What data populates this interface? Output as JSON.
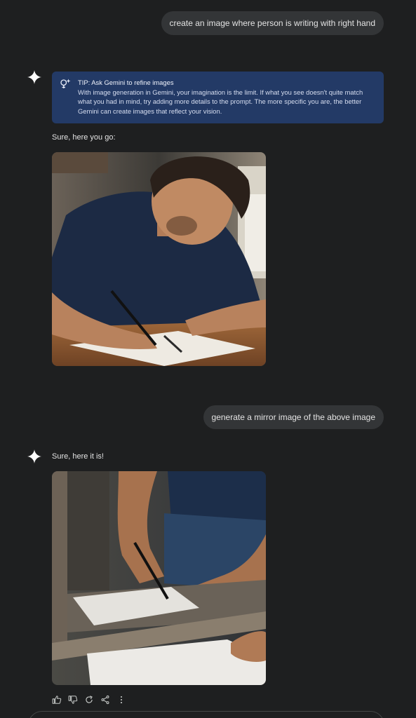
{
  "conversation": {
    "user_prompt_1": "create an image where person is writing with right hand",
    "tip": {
      "title": "TIP: Ask Gemini to refine images",
      "body": "With image generation in Gemini, your imagination is the limit. If what you see doesn't quite match what you had in mind, try adding more details to the prompt. The more specific you are, the better Gemini can create images that reflect your vision."
    },
    "response_1_text": "Sure, here you go:",
    "user_prompt_2": "generate a mirror image of the above image",
    "response_2_text": "Sure, here it is!"
  },
  "actions": {
    "icons": [
      "thumbs-up-icon",
      "thumbs-down-icon",
      "regenerate-icon",
      "share-icon",
      "more-options-icon"
    ]
  },
  "colors": {
    "background": "#1e1f20",
    "user_bubble": "#333537",
    "tip_box": "#233a66",
    "text": "#e3e3e3"
  }
}
